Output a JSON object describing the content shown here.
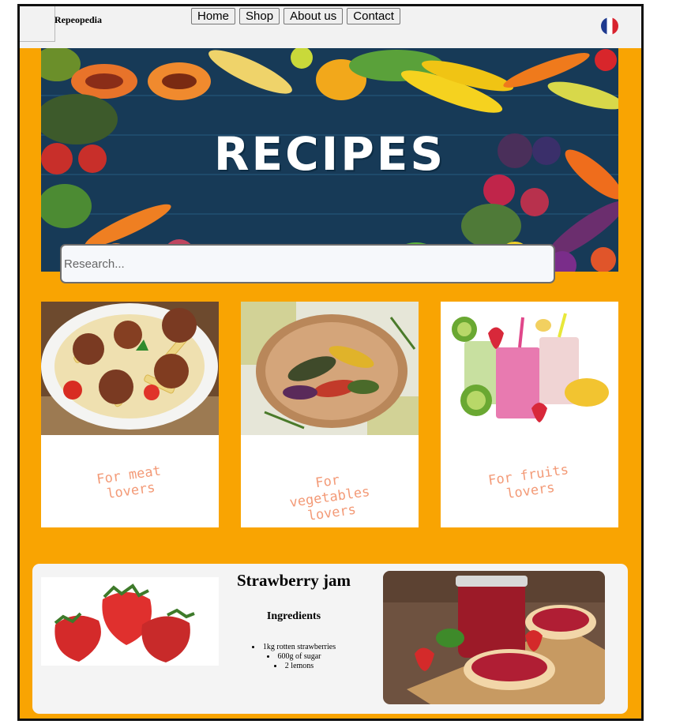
{
  "header": {
    "site_name": "Repeopedia",
    "nav": [
      "Home",
      "Shop",
      "About us",
      "Contact"
    ],
    "language_flag": "french-flag-icon"
  },
  "hero": {
    "title": "RECIPES",
    "search_placeholder": "Research..."
  },
  "categories": [
    {
      "label": "For meat\nlovers",
      "image": "pasta-meatballs-image"
    },
    {
      "label": "For\nvegetables\nlovers",
      "image": "grilled-vegetables-image"
    },
    {
      "label": "For fruits\nlovers",
      "image": "fruit-smoothies-image"
    }
  ],
  "featured": {
    "title": "Strawberry jam",
    "ingredients_heading": "Ingredients",
    "ingredients": [
      "1kg rotten strawberries",
      "600g of sugar",
      "2 lemons"
    ]
  },
  "colors": {
    "page_background": "#f9a402",
    "header_background": "#f2f2f2",
    "card_label": "#f39a77",
    "panel_background": "#f4f4f4"
  }
}
